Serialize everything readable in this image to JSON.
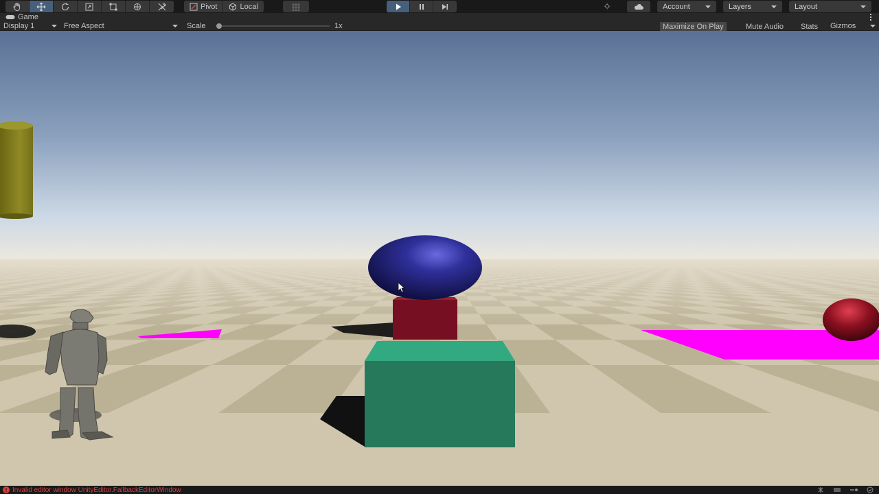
{
  "toolbar": {
    "tools": [
      {
        "name": "hand-tool",
        "icon": "hand-icon",
        "active": false
      },
      {
        "name": "move-tool",
        "icon": "move-arrows-icon",
        "active": true
      },
      {
        "name": "rotate-tool",
        "icon": "rotate-icon",
        "active": false
      },
      {
        "name": "scale-tool",
        "icon": "scale-icon",
        "active": false
      },
      {
        "name": "rect-tool",
        "icon": "rect-transform-icon",
        "active": false
      },
      {
        "name": "transform-tool",
        "icon": "transform-icon",
        "active": false
      },
      {
        "name": "custom-tool",
        "icon": "tools-icon",
        "active": false
      }
    ],
    "pivot_label": "Pivot",
    "local_label": "Local",
    "play_active": true,
    "account_label": "Account",
    "layers_label": "Layers",
    "layout_label": "Layout"
  },
  "game_view": {
    "tab_label": "Game",
    "display_label": "Display 1",
    "aspect_label": "Free Aspect",
    "scale_label": "Scale",
    "scale_value": "1x",
    "maximize_label": "Maximize On Play",
    "maximize_on": true,
    "mute_label": "Mute Audio",
    "stats_label": "Stats",
    "gizmos_label": "Gizmos"
  },
  "status": {
    "message": "Invalid editor window UnityEditor.FallbackEditorWindow"
  },
  "colors": {
    "accent": "#46607c",
    "error": "#d44040",
    "sky_top": "#5a7196",
    "sky_horizon": "#f0eadd",
    "ground_light": "#cfc6ad",
    "ground_dark": "#bbb296",
    "blue_sphere": "#2a2a8a",
    "red_cube": "#7a1525",
    "green_cube": "#2a8f6c",
    "magenta_plane": "#ff00ff",
    "yellow_cylinder": "#8a8420"
  }
}
